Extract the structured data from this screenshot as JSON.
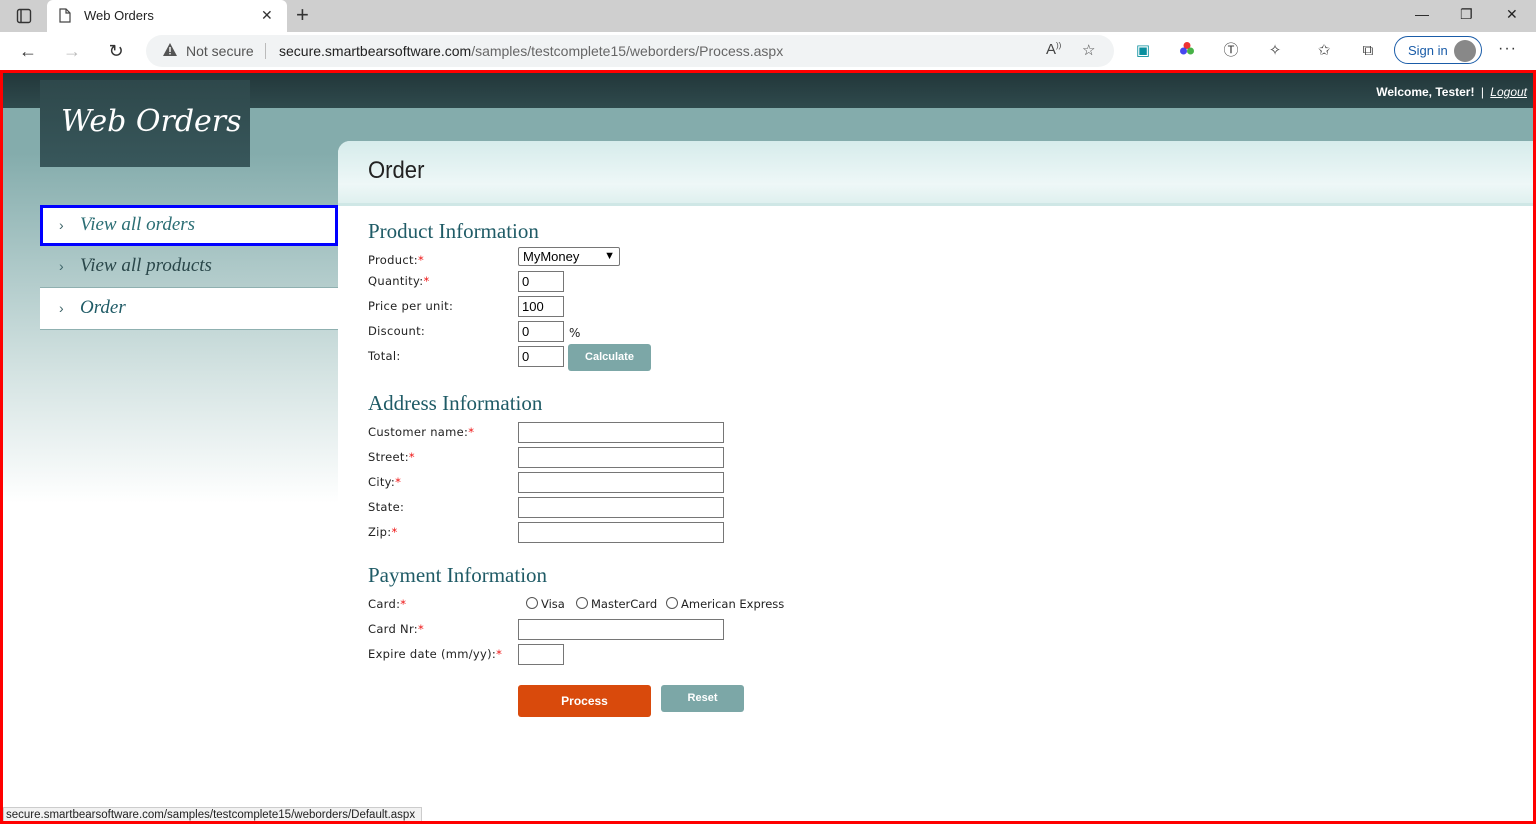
{
  "browser": {
    "tab_title": "Web Orders",
    "not_secure": "Not secure",
    "url_host": "secure.smartbearsoftware.com",
    "url_path": "/samples/testcomplete15/weborders/Process.aspx",
    "signin_label": "Sign in",
    "status_url": "secure.smartbearsoftware.com/samples/testcomplete15/weborders/Default.aspx"
  },
  "header": {
    "logo": "Web Orders",
    "welcome": "Welcome, Tester!",
    "separator": "|",
    "logout": "Logout"
  },
  "menu": {
    "items": [
      {
        "label": "View all orders"
      },
      {
        "label": "View all products"
      },
      {
        "label": "Order"
      }
    ]
  },
  "page": {
    "title": "Order",
    "product_section": "Product Information",
    "address_section": "Address Information",
    "payment_section": "Payment Information"
  },
  "product": {
    "product_label": "Product:",
    "product_value": "MyMoney",
    "quantity_label": "Quantity:",
    "quantity_value": "0",
    "price_label": "Price per unit:",
    "price_value": "100",
    "discount_label": "Discount:",
    "discount_value": "0",
    "discount_unit": "%",
    "total_label": "Total:",
    "total_value": "0",
    "calculate": "Calculate"
  },
  "address": {
    "customer_label": "Customer name:",
    "street_label": "Street:",
    "city_label": "City:",
    "state_label": "State:",
    "zip_label": "Zip:"
  },
  "payment": {
    "card_label": "Card:",
    "cards": [
      "Visa",
      "MasterCard",
      "American Express"
    ],
    "cardnr_label": "Card Nr:",
    "expire_label": "Expire date (mm/yy):"
  },
  "actions": {
    "process": "Process",
    "reset": "Reset"
  },
  "required_mark": "*",
  "colors": {
    "accent_teal": "#1f5b66",
    "process_orange": "#d94a0c",
    "button_teal": "#7ca7a7",
    "highlight_border": "#0000ff",
    "viewport_border": "#ff0000"
  }
}
